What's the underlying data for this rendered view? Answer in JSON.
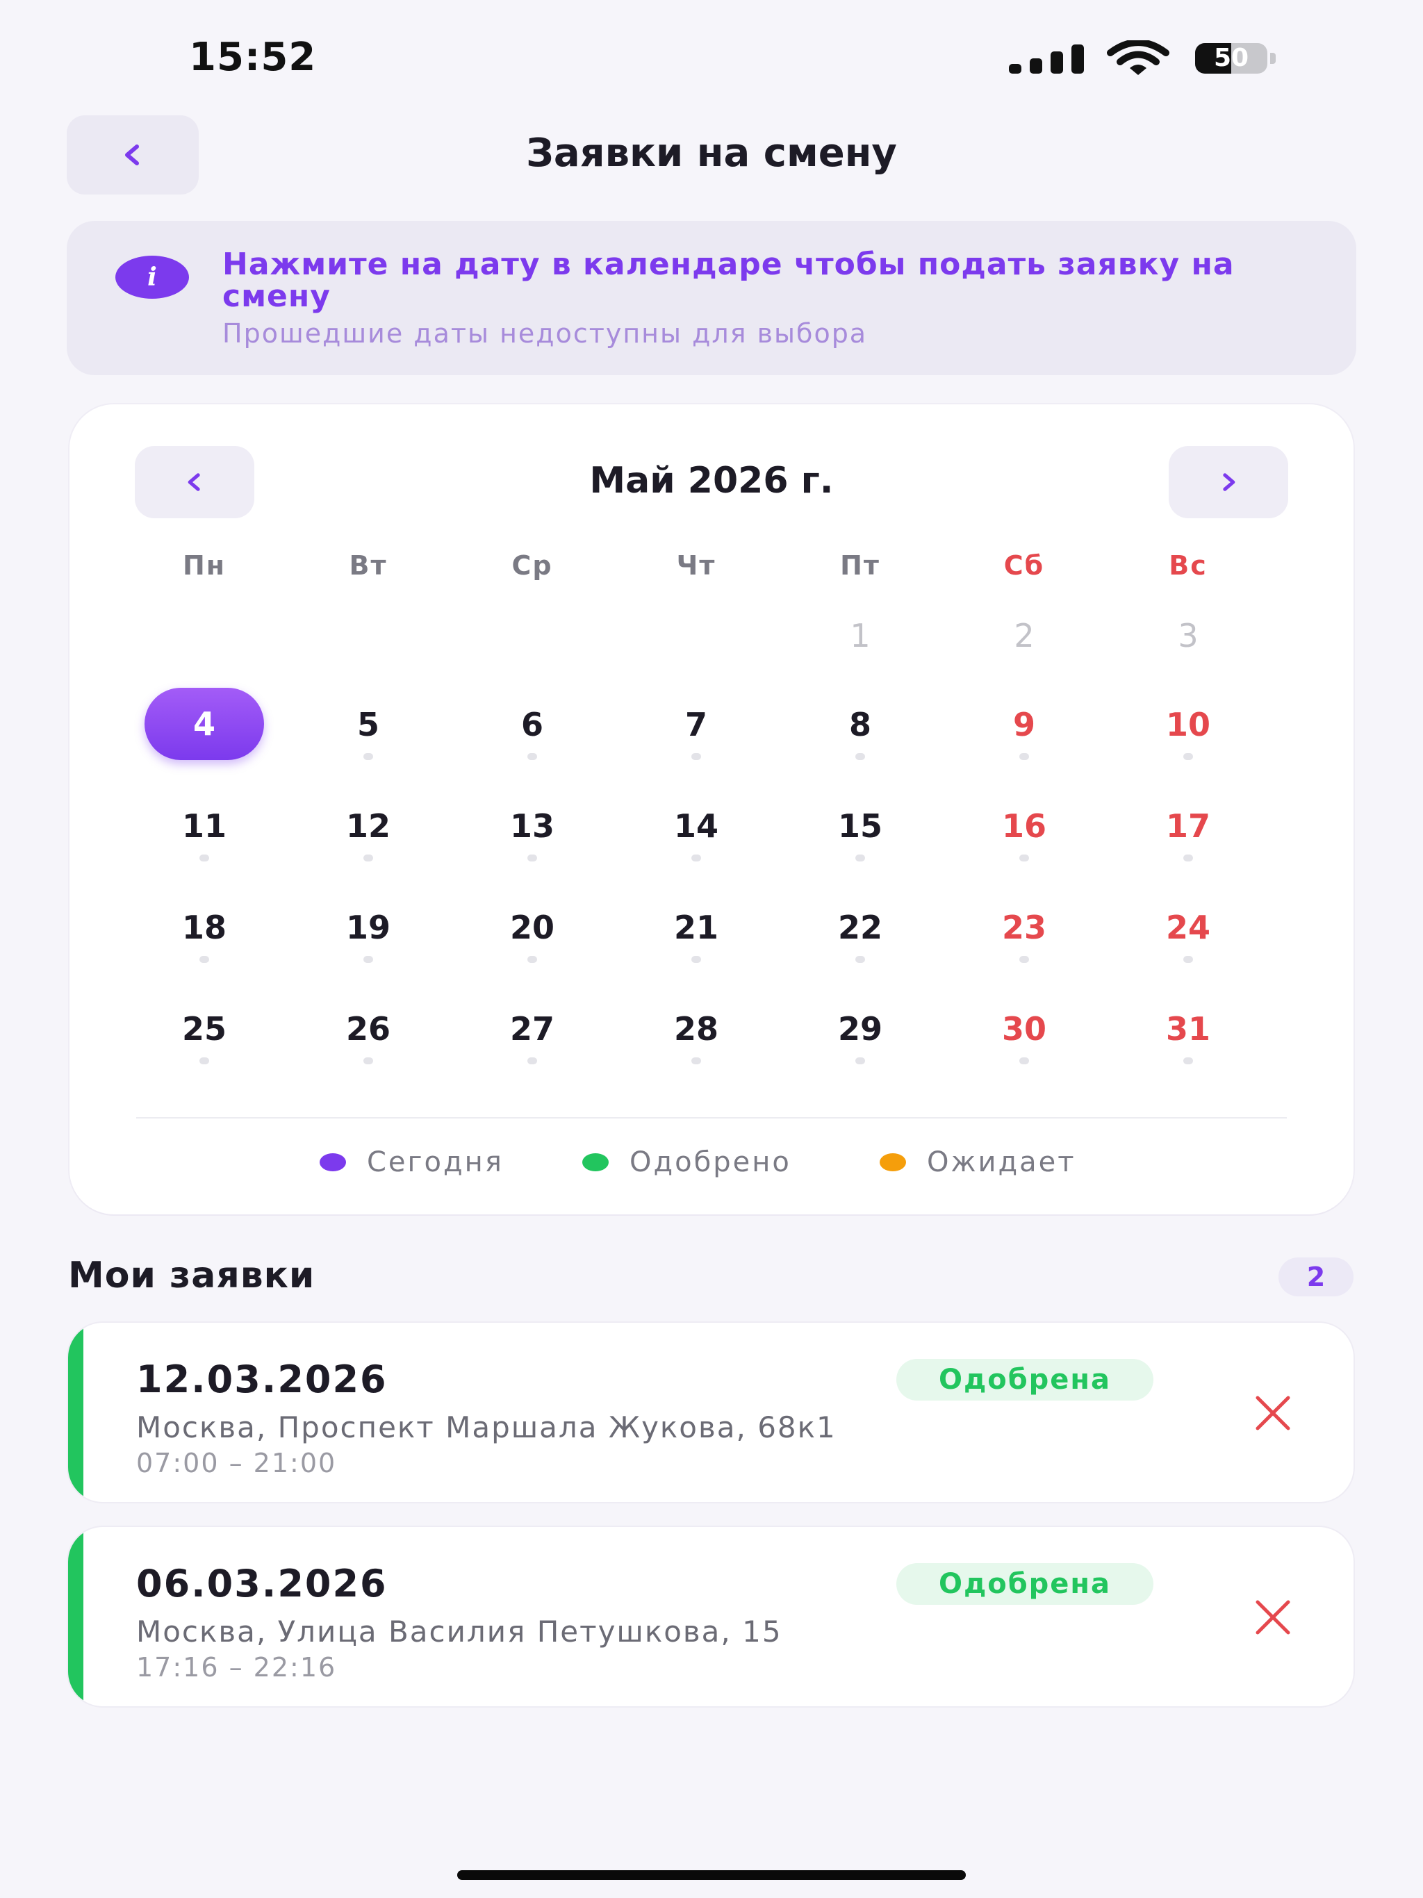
{
  "status_bar": {
    "time": "15:52",
    "battery": "50",
    "battery_level": 0.5
  },
  "header": {
    "title": "Заявки на смену",
    "back_icon": "chevron-left-icon"
  },
  "info": {
    "icon": "i",
    "title": "Нажмите на дату в календаре чтобы подать заявку на смену",
    "subtitle": "Прошедшие даты недоступны для выбора"
  },
  "calendar": {
    "month_label": "Май 2026 г.",
    "weekdays": [
      "Пн",
      "Вт",
      "Ср",
      "Чт",
      "Пт",
      "Сб",
      "Вс"
    ],
    "weeks": [
      [
        "",
        "",
        "",
        "",
        "1",
        "2",
        "3"
      ],
      [
        "4",
        "5",
        "6",
        "7",
        "8",
        "9",
        "10"
      ],
      [
        "11",
        "12",
        "13",
        "14",
        "15",
        "16",
        "17"
      ],
      [
        "18",
        "19",
        "20",
        "21",
        "22",
        "23",
        "24"
      ],
      [
        "25",
        "26",
        "27",
        "28",
        "29",
        "30",
        "31"
      ]
    ],
    "today": "4",
    "legend": [
      {
        "label": "Сегодня",
        "color": "#7c3aed"
      },
      {
        "label": "Одобрено",
        "color": "#22c55e"
      },
      {
        "label": "Ожидает",
        "color": "#f59e0b"
      }
    ]
  },
  "requests": {
    "title": "Мои заявки",
    "count": "2",
    "items": [
      {
        "date": "12.03.2026",
        "status": "Одобрена",
        "address": "Москва, Проспект Маршала Жукова, 68к1",
        "hours": "07:00 – 21:00"
      },
      {
        "date": "06.03.2026",
        "status": "Одобрена",
        "address": "Москва, Улица Василия Петушкова, 15",
        "hours": "17:16 – 22:16"
      }
    ]
  },
  "colors": {
    "accent": "#7c3aed",
    "weekend": "#e5484d",
    "approved": "#22c55e",
    "pending": "#f59e0b"
  }
}
